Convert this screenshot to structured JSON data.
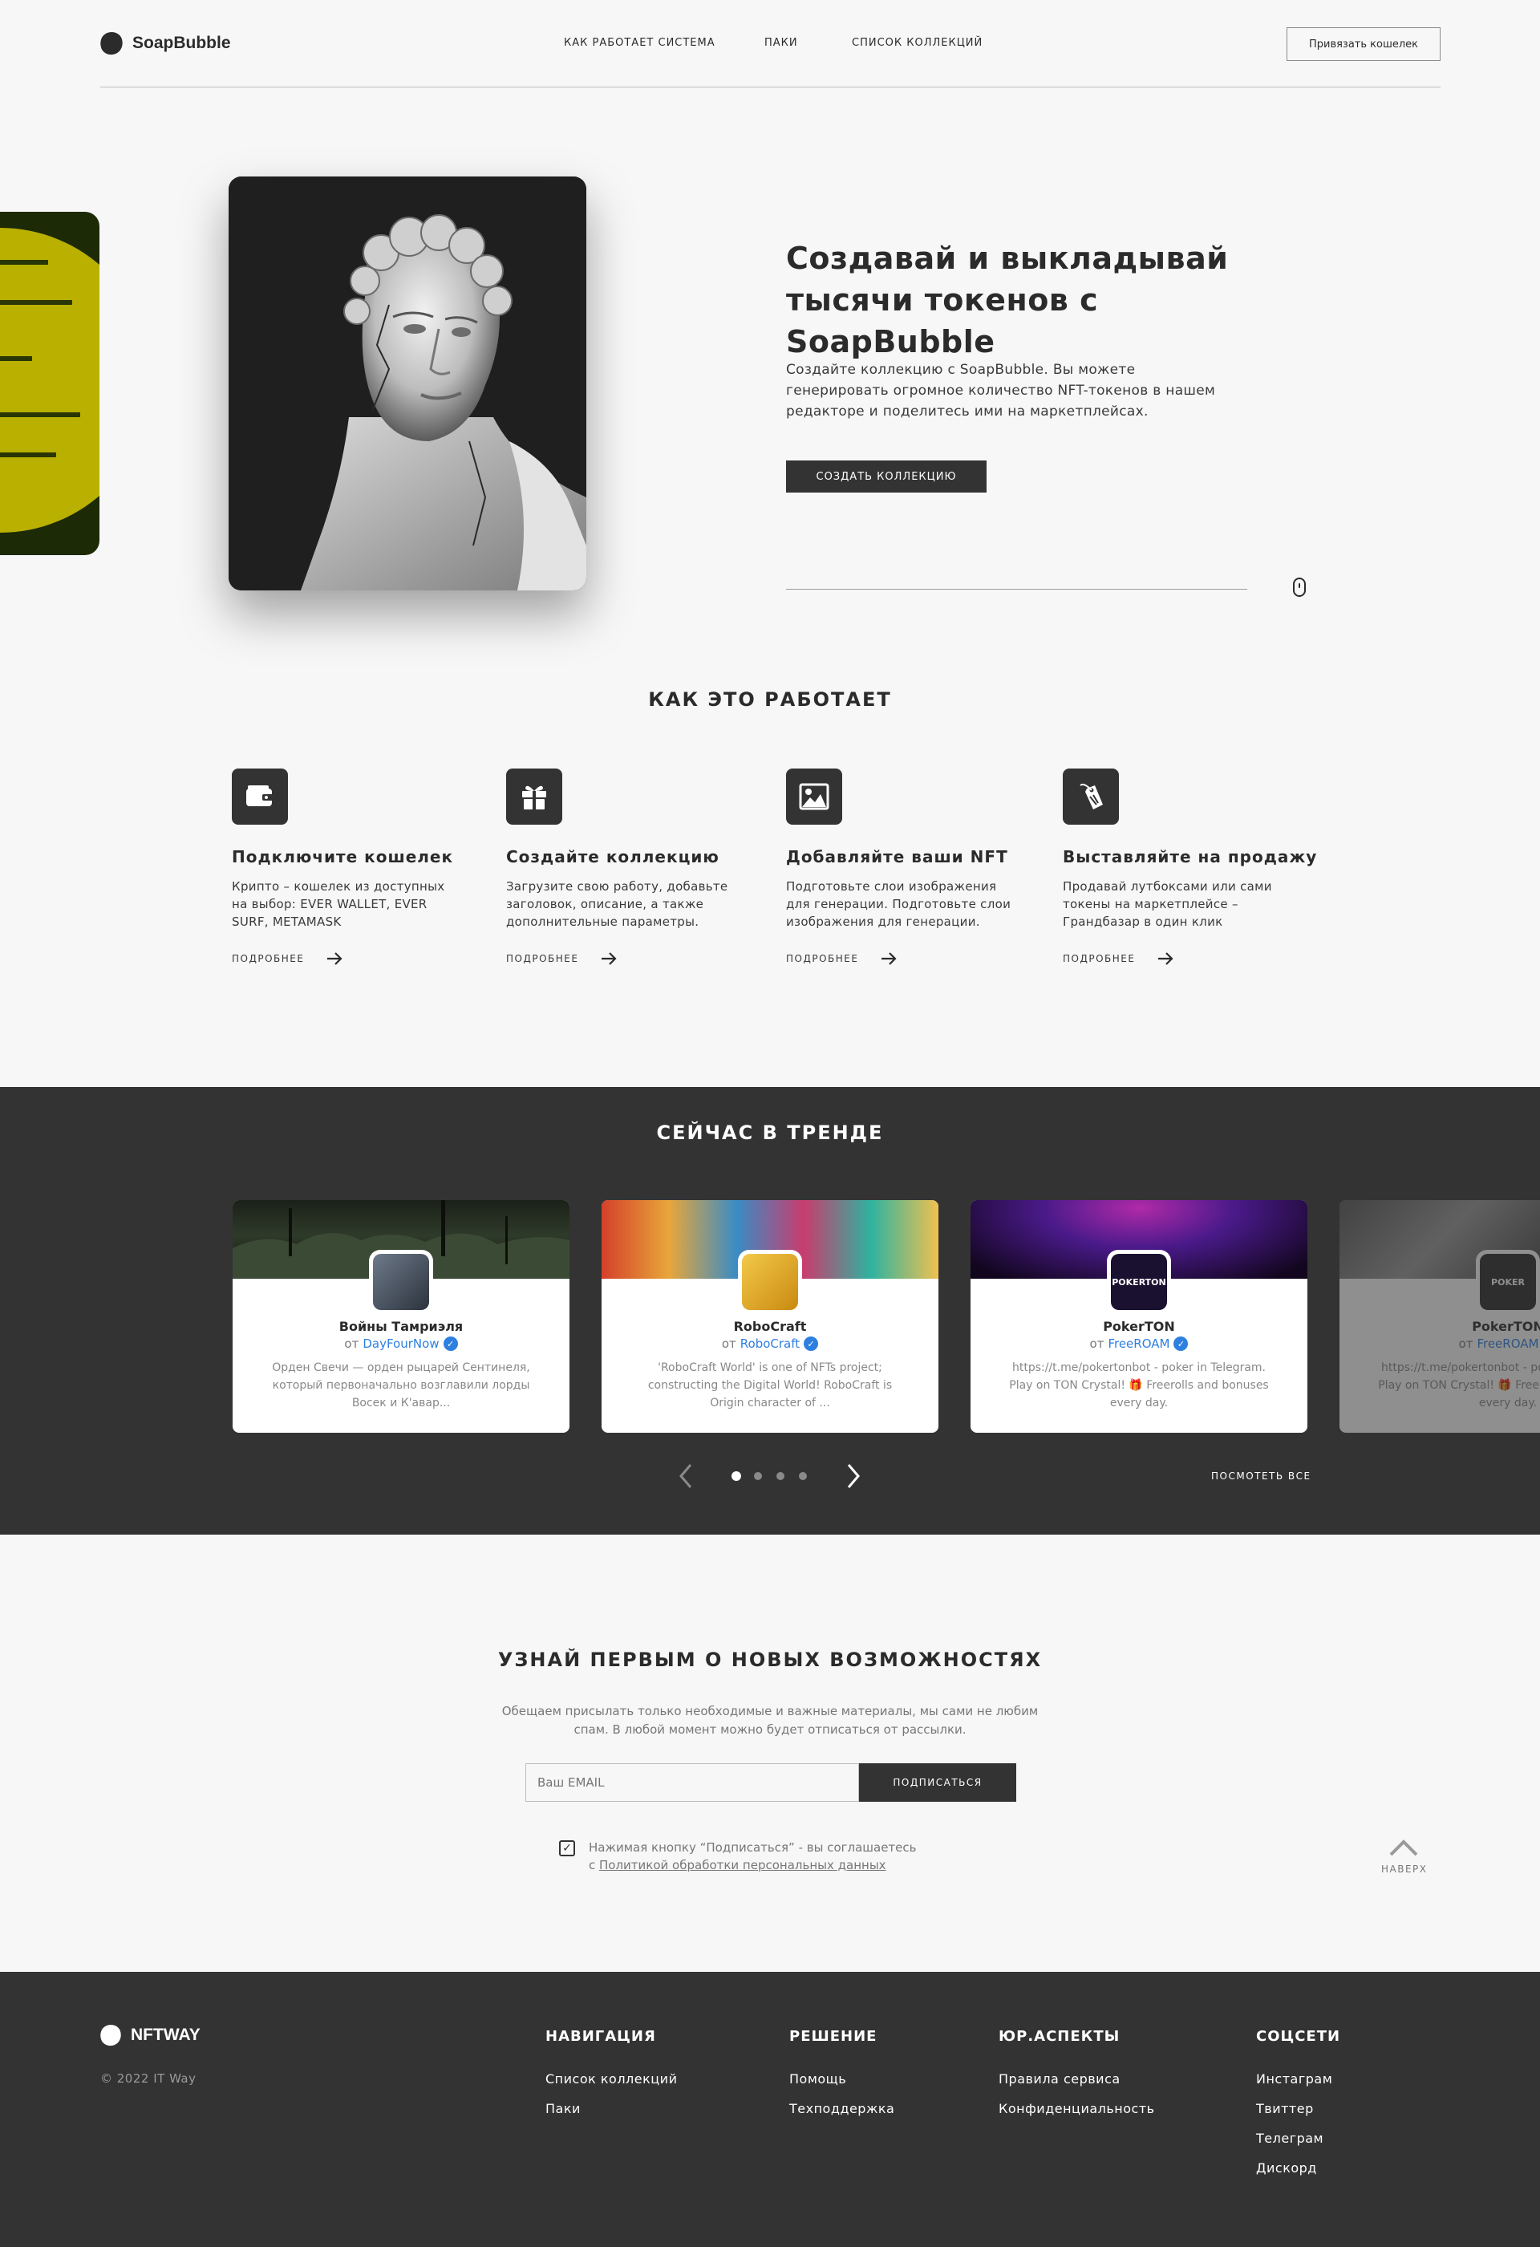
{
  "header": {
    "logo_text": "SoapBubble",
    "nav": [
      "КАК РАБОТАЕТ СИСТЕМА",
      "ПАКИ",
      "СПИСОК КОЛЛЕКЦИЙ"
    ],
    "wallet_button": "Привязать кошелек"
  },
  "hero": {
    "title": "Создавай и выкладывай тысячи токенов с SoapBubble",
    "description": "Создайте коллекцию с SoapBubble. Вы можете генерировать  огромное количество NFT-токенов в нашем редакторе и поделитесь ими на маркетплейсах.",
    "cta": "СОЗДАТЬ КОЛЛЕКЦИЮ"
  },
  "how": {
    "title": "КАК ЭТО РАБОТАЕТ",
    "more_label": "ПОДРОБНЕЕ",
    "steps": [
      {
        "icon": "wallet-icon",
        "title": "Подключите кошелек",
        "desc": "Крипто – кошелек из доступных на выбор: EVER WALLET, EVER SURF, METAMASK"
      },
      {
        "icon": "gift-icon",
        "title": "Создайте коллекцию",
        "desc": "Загрузите свою работу, добавьте заголовок, описание, а также дополнительные параметры."
      },
      {
        "icon": "image-icon",
        "title": "Добавляйте ваши NFT",
        "desc": "Подготовьте слои изображения для генерации. Подготовьте слои изображения для генерации."
      },
      {
        "icon": "price-tag-icon",
        "title": "Выставляйте на продажу",
        "desc": "Продавай лутбоксами или сами токены на маркетплейсе – Грандбазар в один клик"
      }
    ]
  },
  "trending": {
    "title": "СЕЙЧАС В ТРЕНДЕ",
    "by_label": "от",
    "see_all": "ПОСМОТЕТЬ ВСЕ",
    "cards": [
      {
        "name": "Войны Тамриэля",
        "author": "DayFourNow",
        "desc": "Орден Свечи — орден рыцарей Сентинеля, который первоначально возглавили лорды Восек и К'авар..."
      },
      {
        "name": "RoboCraft",
        "author": "RoboCraft",
        "desc": "'RoboCraft World' is one of NFTs project; constructing the Digital World! RoboCraft is Origin character of ..."
      },
      {
        "name": "PokerTON",
        "author": "FreeROAM",
        "desc": "https://t.me/pokertonbot - poker in Telegram. Play on TON Crystal! 🎁 Freerolls and bonuses every day."
      },
      {
        "name": "PokerTON",
        "author": "FreeROAM",
        "desc": "https://t.me/pokertonbot - poker in Telegram. Play on TON Crystal! 🎁 Freerolls and bonuses every day."
      }
    ],
    "avatar_labels": [
      "",
      "",
      "POKERTON",
      "POKER"
    ],
    "pagination": {
      "pages": 4,
      "current": 1
    }
  },
  "subscribe": {
    "title": "УЗНАЙ ПЕРВЫМ О НОВЫХ ВОЗМОЖНОСТЯХ",
    "desc": "Обещаем присылать только необходимые и важные материалы, мы сами не любим спам. В любой момент можно будет отписаться от рассылки.",
    "placeholder": "Ваш EMAIL",
    "button": "ПОДПИСАТЬСЯ",
    "consent_text": "Нажимая кнопку “Подписаться” - вы соглашаетесь",
    "consent_prefix": "с ",
    "consent_link": "Политикой обработки персональных данных",
    "consent_checked": true,
    "up_label": "НАВЕРХ"
  },
  "footer": {
    "logo_text": "NFTWAY",
    "copyright": "© 2022 IT Way",
    "columns": [
      {
        "title": "НАВИГАЦИЯ",
        "links": [
          "Список коллекций",
          "Паки"
        ]
      },
      {
        "title": "РЕШЕНИЕ",
        "links": [
          "Помощь",
          "Техподдержка"
        ]
      },
      {
        "title": "ЮР.АСПЕКТЫ",
        "links": [
          "Правила сервиса",
          "Конфиденциальность"
        ]
      },
      {
        "title": "СОЦСЕТИ",
        "links": [
          "Инстаграм",
          "Твиттер",
          "Телеграм",
          "Дискорд"
        ]
      }
    ]
  },
  "colors": {
    "dark": "#333333",
    "background": "#f7f7f7",
    "accent_blue": "#2d7fe0",
    "side_card_yellow": "#b9b000"
  }
}
